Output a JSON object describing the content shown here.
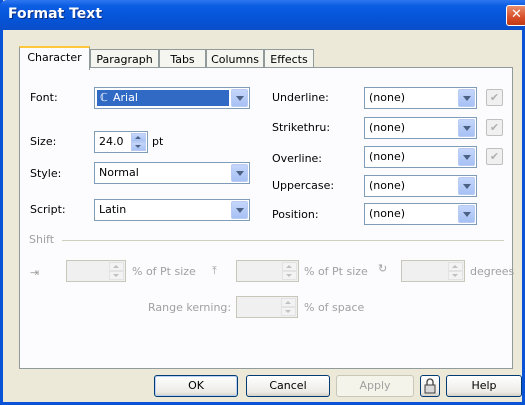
{
  "window": {
    "title": "Format Text",
    "close_glyph": "✕"
  },
  "tabs": [
    {
      "label": "Character",
      "active": true
    },
    {
      "label": "Paragraph",
      "active": false
    },
    {
      "label": "Tabs",
      "active": false
    },
    {
      "label": "Columns",
      "active": false
    },
    {
      "label": "Effects",
      "active": false
    }
  ],
  "character": {
    "font_label": "Font:",
    "font_value": "Arial",
    "font_icon": "truetype-font-icon",
    "size_label": "Size:",
    "size_value": "24.0",
    "size_unit": "pt",
    "style_label": "Style:",
    "style_value": "Normal",
    "script_label": "Script:",
    "script_value": "Latin",
    "underline_label": "Underline:",
    "underline_value": "(none)",
    "strikethru_label": "Strikethru:",
    "strikethru_value": "(none)",
    "overline_label": "Overline:",
    "overline_value": "(none)",
    "uppercase_label": "Uppercase:",
    "uppercase_value": "(none)",
    "position_label": "Position:",
    "position_value": "(none)",
    "shift_label": "Shift",
    "horizontal_shift_unit": "% of Pt size",
    "vertical_shift_unit": "% of Pt size",
    "rotation_unit": "degrees",
    "range_kerning_label": "Range kerning:",
    "range_kerning_unit": "% of space"
  },
  "buttons": {
    "ok": "OK",
    "cancel": "Cancel",
    "apply": "Apply",
    "help": "Help"
  },
  "colors": {
    "title_bar": "#0554d8",
    "selection": "#316ac5",
    "tab_highlight": "#ffc83c"
  }
}
